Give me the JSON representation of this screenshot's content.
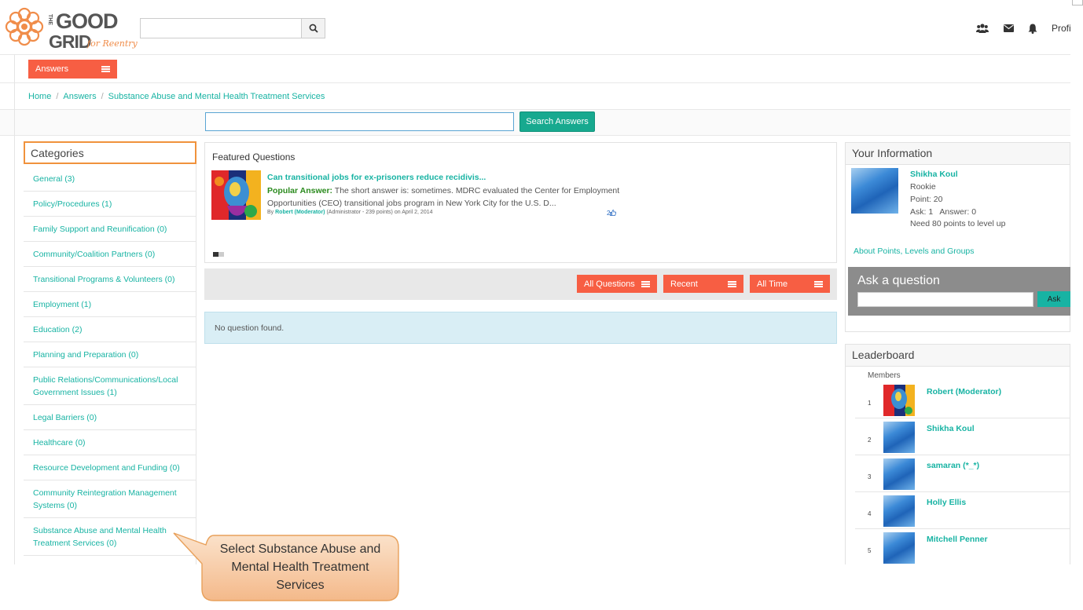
{
  "header": {
    "logo": {
      "line1": "THE",
      "word1": "GOOD",
      "word2": "GRID",
      "tag": "for Reentry"
    },
    "search": {
      "value": "",
      "placeholder": ""
    },
    "icons": [
      "users-icon",
      "envelope-icon",
      "bell-icon"
    ],
    "profile_label": "Profi"
  },
  "nav": {
    "answers_label": "Answers"
  },
  "breadcrumb": [
    "Home",
    "Answers",
    "Substance Abuse and Mental Health Treatment Services"
  ],
  "answer_search": {
    "value": "",
    "button": "Search Answers"
  },
  "categories": {
    "title": "Categories",
    "items": [
      "General (3)",
      "Policy/Procedures (1)",
      "Family Support and Reunification (0)",
      "Community/Coalition Partners (0)",
      "Transitional Programs & Volunteers (0)",
      "Employment (1)",
      "Education (2)",
      "Planning and Preparation (0)",
      "Public Relations/Communications/Local Government Issues (1)",
      "Legal Barriers (0)",
      "Healthcare (0)",
      "Resource Development and Funding (0)",
      "Community Reintegration Management Systems (0)",
      "Substance Abuse and Mental Health Treatment Services (0)"
    ]
  },
  "featured": {
    "title": "Featured Questions",
    "question": "Can transitional jobs for ex-prisoners reduce recidivis...",
    "answer_label": "Popular Answer:",
    "answer_text": "The short answer is: sometimes. MDRC evaluated the Center for Employment Opportunities (CEO) transitional jobs program in New York City for the U.S. D...",
    "by": "By",
    "author": "Robert (Moderator)",
    "author_meta": "(Administrator - 239 points)",
    "date": "on April 2, 2014",
    "votes": "2"
  },
  "filters": [
    "All Questions",
    "Recent",
    "All Time"
  ],
  "empty_message": "No question found.",
  "your_info": {
    "title": "Your Information",
    "name": "Shikha Koul",
    "level": "Rookie",
    "point": "Point: 20",
    "ask_answer": "Ask: 1   Answer: 0",
    "next_level": "Need 80 points to level up",
    "about_link": "About Points, Levels and Groups"
  },
  "ask": {
    "title": "Ask a question",
    "value": "",
    "button": "Ask"
  },
  "leaderboard": {
    "title": "Leaderboard",
    "members_label": "Members",
    "rows": [
      {
        "rank": "1",
        "name": "Robert (Moderator)"
      },
      {
        "rank": "2",
        "name": "Shikha Koul"
      },
      {
        "rank": "3",
        "name": "samaran (*_*)"
      },
      {
        "rank": "4",
        "name": "Holly Ellis"
      },
      {
        "rank": "5",
        "name": "Mitchell Penner"
      }
    ]
  },
  "callout": {
    "text": "Select Substance Abuse and Mental Health Treatment Services"
  },
  "colors": {
    "accent": "#f75e43",
    "link": "#17b3a3",
    "search_button": "#17a98f",
    "callout_fill": "#f7c9a2",
    "callout_border": "#e8a05a"
  }
}
